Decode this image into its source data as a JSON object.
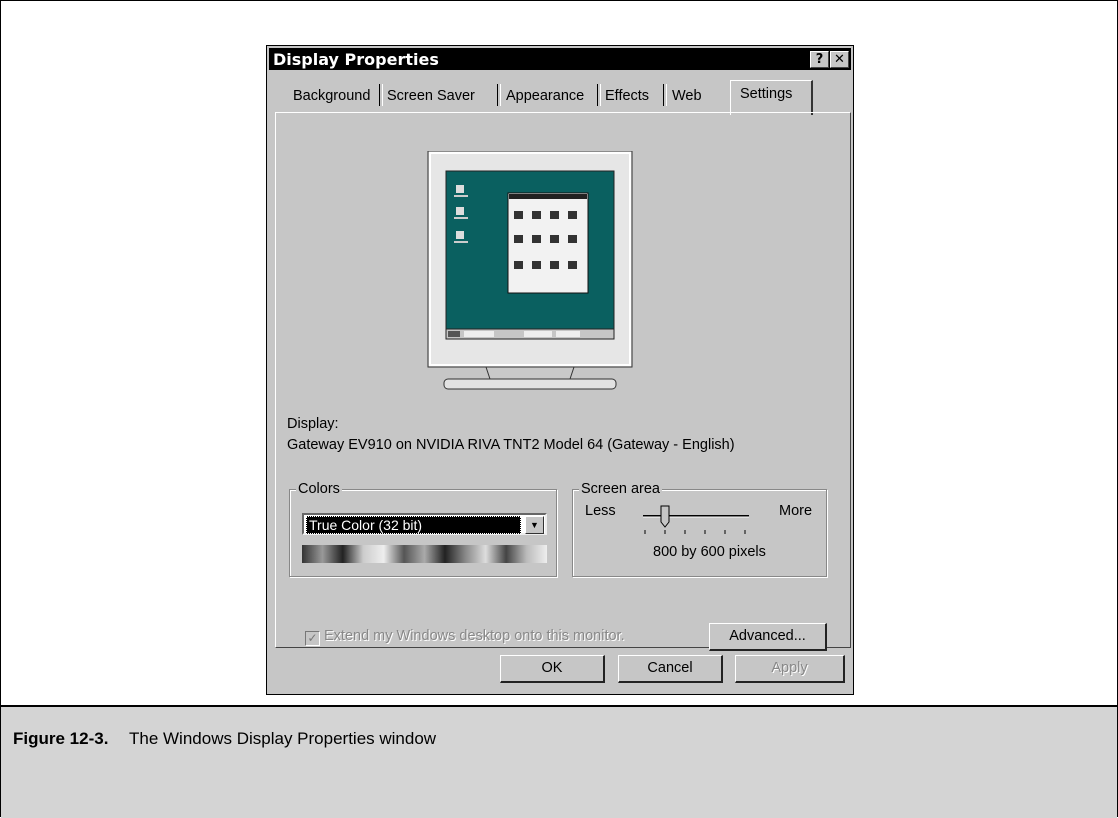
{
  "window": {
    "title": "Display Properties",
    "help_btn": "?",
    "close_btn": "✕",
    "tabs": [
      {
        "label": "Background"
      },
      {
        "label": "Screen Saver"
      },
      {
        "label": "Appearance"
      },
      {
        "label": "Effects"
      },
      {
        "label": "Web"
      },
      {
        "label": "Settings",
        "active": true
      }
    ]
  },
  "display": {
    "label": "Display:",
    "value": "Gateway EV910 on NVIDIA RIVA TNT2 Model 64 (Gateway - English)"
  },
  "colors": {
    "group_label": "Colors",
    "selected": "True Color (32 bit)"
  },
  "screen_area": {
    "group_label": "Screen area",
    "less": "Less",
    "more": "More",
    "value": "800 by 600 pixels",
    "slider_position": 1,
    "slider_stops": 6
  },
  "extend": {
    "label": "Extend my Windows desktop onto this monitor.",
    "checked": true,
    "enabled": false
  },
  "buttons": {
    "advanced": "Advanced...",
    "ok": "OK",
    "cancel": "Cancel",
    "apply": "Apply"
  },
  "caption": {
    "number": "Figure 12-3.",
    "text": "The Windows Display Properties window"
  },
  "colors_palette": {
    "accent": "#000000",
    "face": "#c6c6c6",
    "desktop": "#0a6060"
  }
}
